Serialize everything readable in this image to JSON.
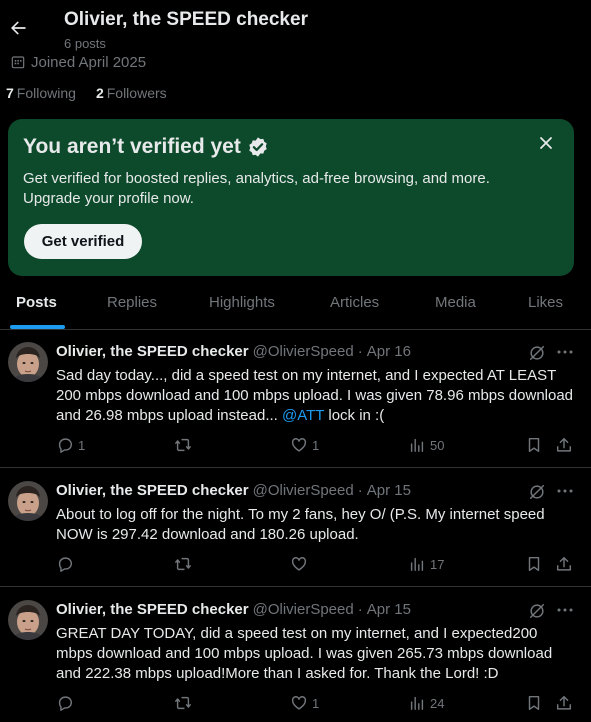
{
  "header": {
    "title": "Olivier, the SPEED checker",
    "posts_count": "6 posts",
    "joined": "Joined April 2025",
    "following_count": "7",
    "following_label": "Following",
    "followers_count": "2",
    "followers_label": "Followers"
  },
  "verify_card": {
    "title": "You aren’t verified yet",
    "description": "Get verified for boosted replies, analytics, ad-free browsing, and more. Upgrade your profile now.",
    "button": "Get verified",
    "background_color": "#0d4a2b"
  },
  "tabs": [
    {
      "label": "Posts",
      "active": true
    },
    {
      "label": "Replies",
      "active": false
    },
    {
      "label": "Highlights",
      "active": false
    },
    {
      "label": "Articles",
      "active": false
    },
    {
      "label": "Media",
      "active": false
    },
    {
      "label": "Likes",
      "active": false
    }
  ],
  "accent_color": "#1d9bf0",
  "posts": [
    {
      "author": "Olivier, the SPEED checker",
      "handle": "@OlivierSpeed",
      "date": "Apr 16",
      "text_before": "Sad day today..., did a speed test on my internet, and I expected AT LEAST 200 mbps download and 100 mbps upload. I was given 78.96 mbps download and 26.98 mbps upload instead... ",
      "mention": "@ATT",
      "text_after": " lock in :(",
      "replies": "1",
      "reposts": "",
      "likes": "1",
      "views": "50"
    },
    {
      "author": "Olivier, the SPEED checker",
      "handle": "@OlivierSpeed",
      "date": "Apr 15",
      "text_before": "About to log off for the night. To my 2 fans, hey O/ (P.S. My internet speed NOW is 297.42 download and 180.26 upload.",
      "mention": "",
      "text_after": "",
      "replies": "",
      "reposts": "",
      "likes": "",
      "views": "17"
    },
    {
      "author": "Olivier, the SPEED checker",
      "handle": "@OlivierSpeed",
      "date": "Apr 15",
      "text_before": "GREAT DAY TODAY, did a speed test on my internet, and I expected200 mbps download and 100 mbps upload. I was given 265.73 mbps download and 222.38 mbps upload!More than I asked for. Thank the Lord! :D",
      "mention": "",
      "text_after": "",
      "replies": "",
      "reposts": "",
      "likes": "1",
      "views": "24"
    }
  ]
}
